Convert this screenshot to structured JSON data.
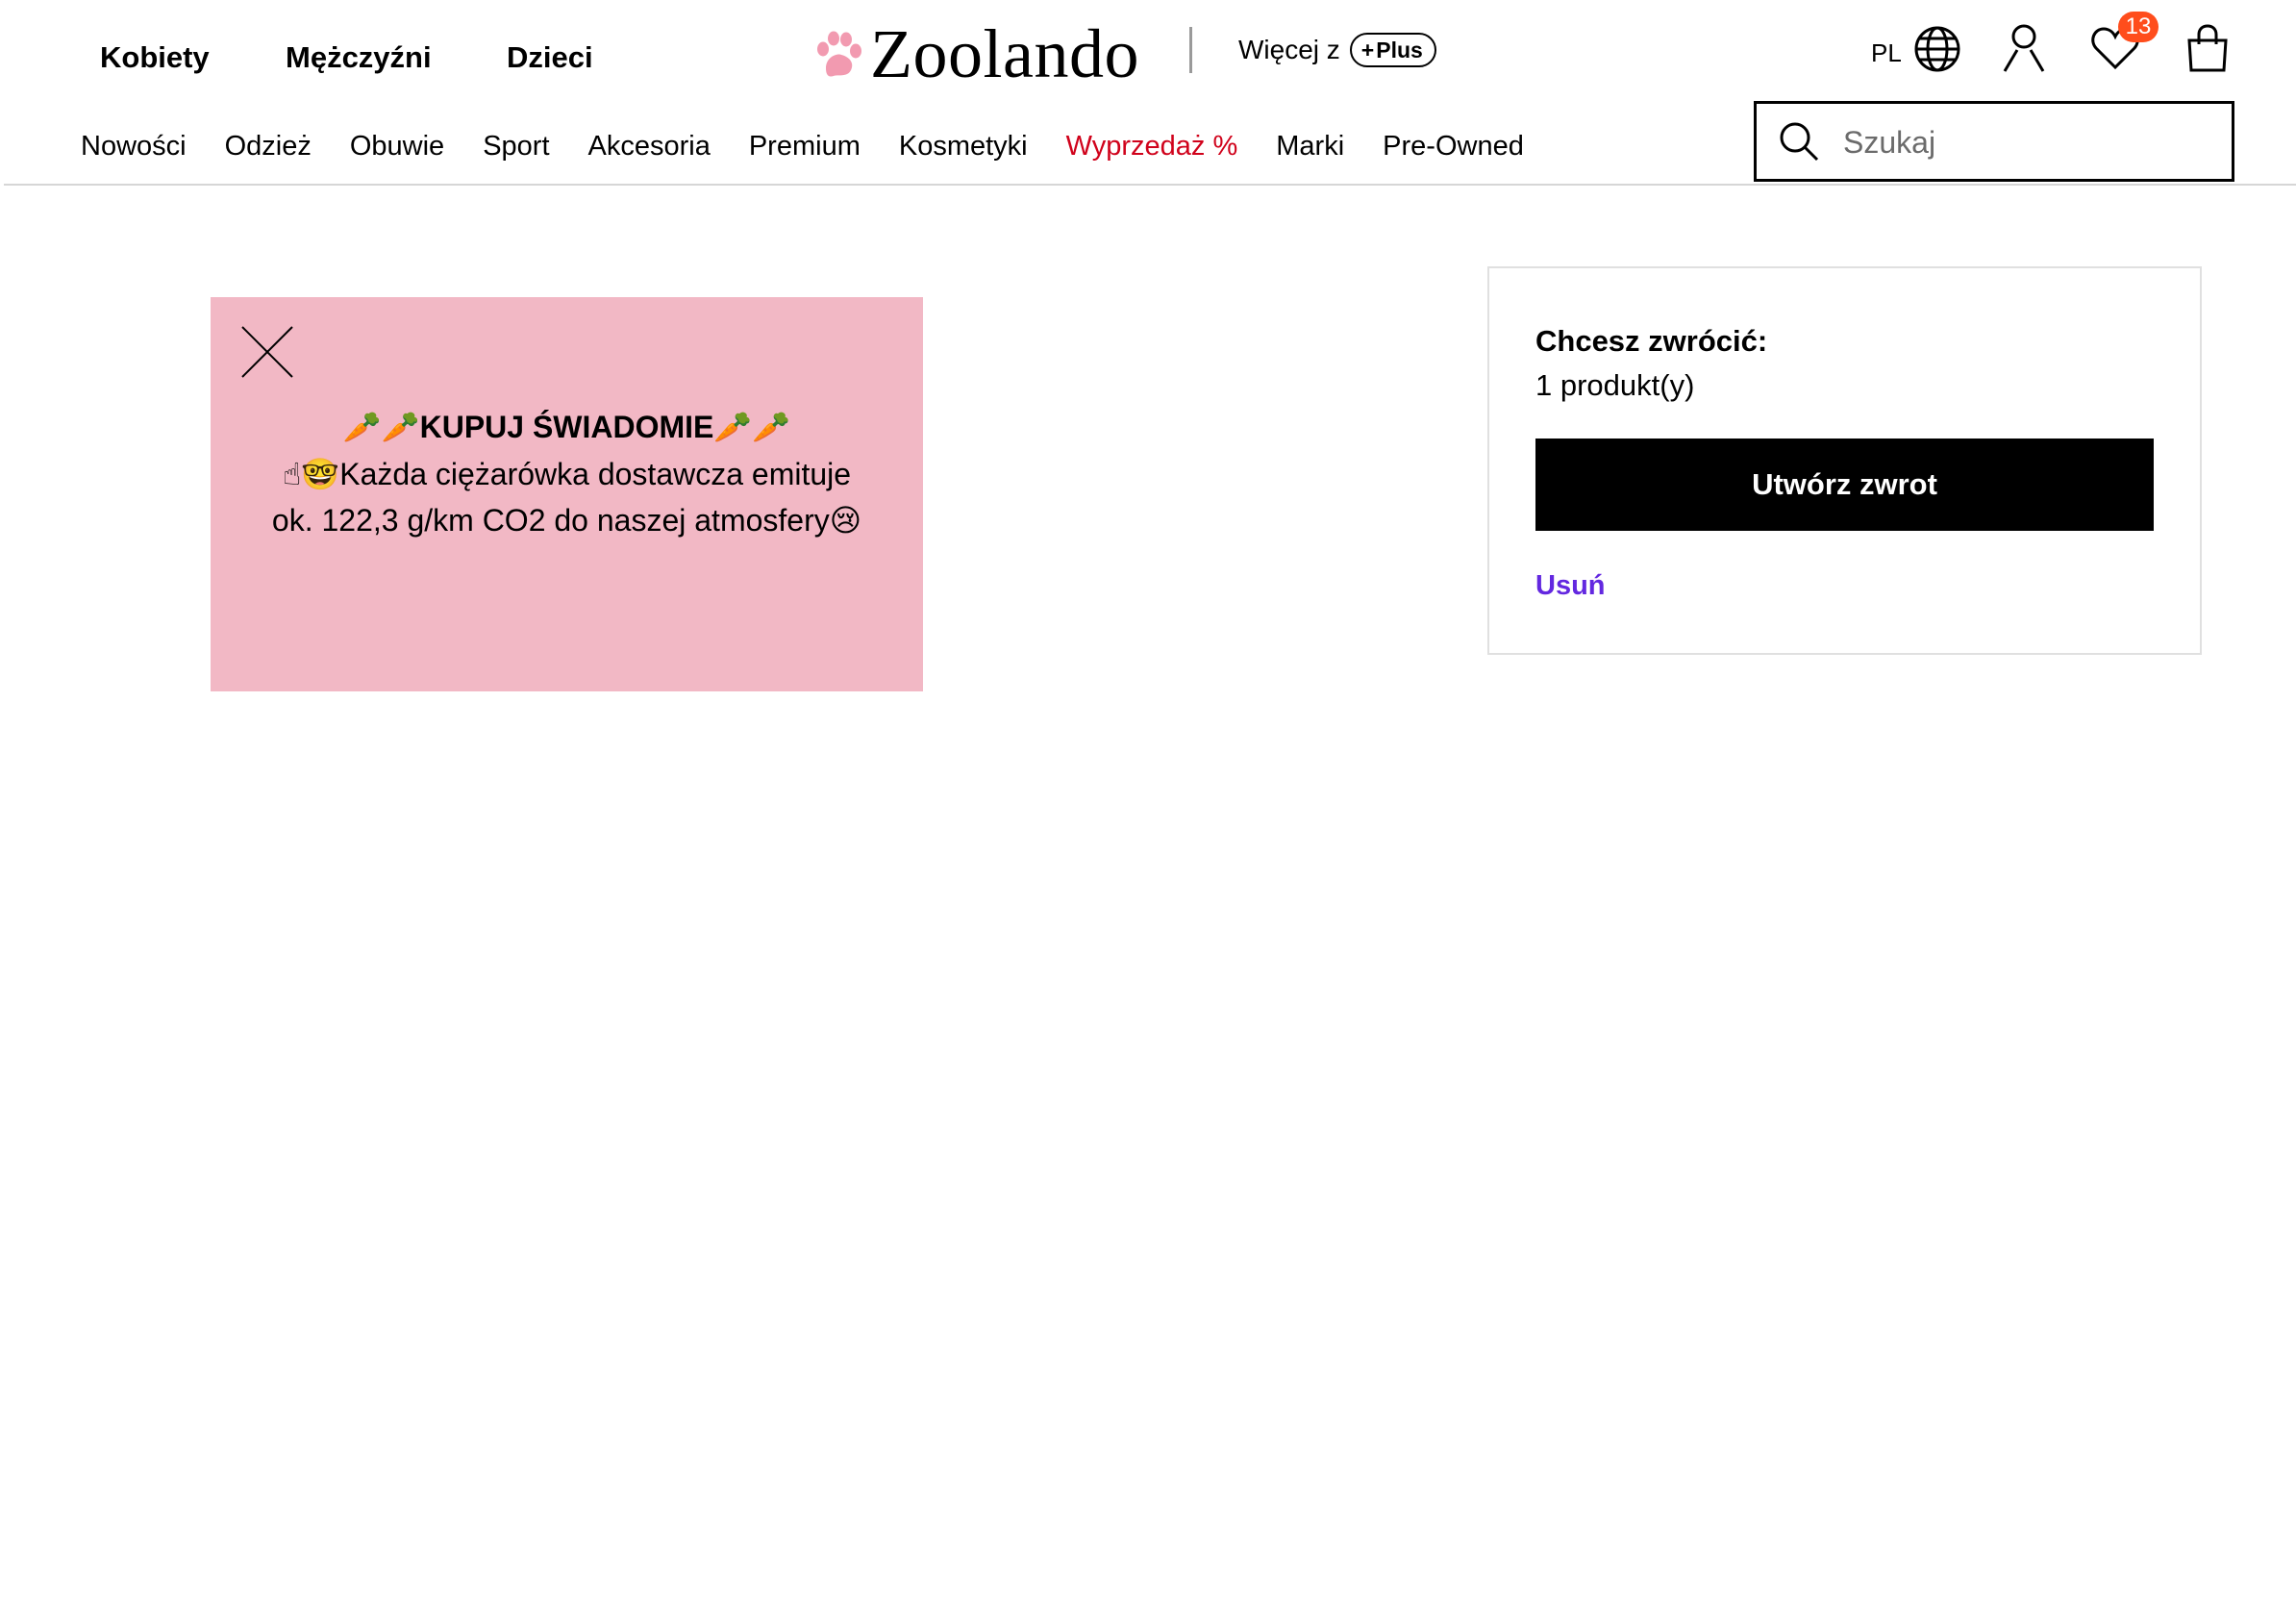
{
  "header": {
    "gender_nav": [
      "Kobiety",
      "Mężczyźni",
      "Dzieci"
    ],
    "logo_text": "Zoolando",
    "more_from_label": "Więcej z",
    "plus_label": "Plus",
    "language": "PL",
    "wishlist_count": "13",
    "search_placeholder": "Szukaj",
    "icons": [
      "paw-logo-icon",
      "globe-icon",
      "user-icon",
      "heart-icon",
      "bag-icon",
      "search-icon"
    ]
  },
  "category_nav": [
    "Nowości",
    "Odzież",
    "Obuwie",
    "Sport",
    "Akcesoria",
    "Premium",
    "Kosmetyki",
    "Wyprzedaż %",
    "Marki",
    "Pre-Owned"
  ],
  "colors": {
    "sale": "#d0021b",
    "promo_bg": "#f2b8c5",
    "link_purple": "#6328e0",
    "badge": "#ff4d1c"
  },
  "promo": {
    "title": "🥕🥕KUPUJ ŚWIADOMIE🥕🥕",
    "line1": "☝🤓Każda ciężarówka dostawcza emituje",
    "line2": "ok. 122,3 g/km CO2 do naszej atmosfery😢"
  },
  "return_panel": {
    "title": "Chcesz zwrócić:",
    "count": "1 produkt(y)",
    "button_label": "Utwórz zwrot",
    "remove_label": "Usuń"
  }
}
